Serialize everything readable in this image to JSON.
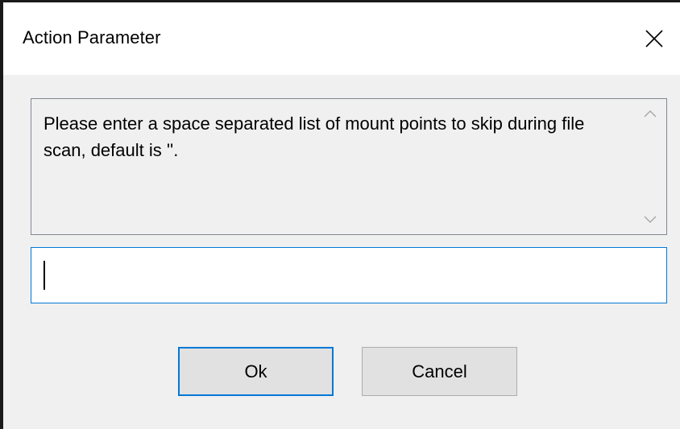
{
  "window": {
    "title": "Action Parameter",
    "close_icon": "close-icon"
  },
  "message": {
    "text": "Please enter a space separated list of mount points to skip during file scan, default is ''."
  },
  "scrollbar": {
    "up_icon": "chevron-up-icon",
    "down_icon": "chevron-down-icon"
  },
  "input": {
    "value": "",
    "placeholder": ""
  },
  "buttons": {
    "ok_label": "Ok",
    "cancel_label": "Cancel"
  },
  "colors": {
    "focus_accent": "#0078d7",
    "button_face": "#e1e1e1",
    "dialog_background": "#f0f0f0"
  }
}
